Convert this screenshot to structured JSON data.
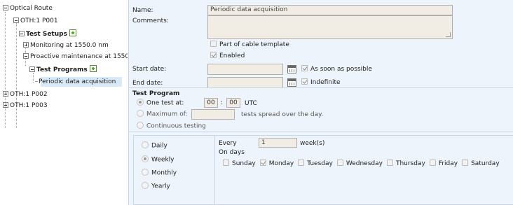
{
  "tree": {
    "root": "Optical Route",
    "oth1": "OTH:1 P001",
    "test_setups": "Test Setups",
    "monitoring": "Monitoring at 1550.0 nm",
    "proactive": "Proactive maintenance at 1550",
    "test_programs": "Test Programs",
    "periodic": "Periodic data acquisition",
    "oth2": "OTH:1 P002",
    "oth3": "OTH:1 P003"
  },
  "form": {
    "name_label": "Name:",
    "name_value": "Periodic data acquisition",
    "comments_label": "Comments:",
    "comments_value": "",
    "cable_template_label": "Part of cable template",
    "cable_template_checked": false,
    "enabled_label": "Enabled",
    "enabled_checked": true,
    "start_date_label": "Start date:",
    "start_date_value": "",
    "asap_label": "As soon as possible",
    "asap_checked": true,
    "end_date_label": "End date:",
    "end_date_value": "",
    "indefinite_label": "Indefinite",
    "indefinite_checked": true
  },
  "program": {
    "title": "Test Program",
    "one_test_label": "One test at:",
    "hour": "00",
    "colon": ":",
    "minute": "00",
    "tz": "UTC",
    "maximum_label": "Maximum of:",
    "maximum_value": "",
    "spread_label": "tests spread over the day.",
    "continuous_label": "Continuous testing",
    "selected_mode": "one_test"
  },
  "schedule": {
    "periods": [
      "Daily",
      "Weekly",
      "Monthly",
      "Yearly"
    ],
    "selected_period": "Weekly",
    "every_label": "Every",
    "every_value": "1",
    "unit_label": "week(s)",
    "on_days_label": "On days",
    "days": [
      {
        "label": "Sunday",
        "checked": false
      },
      {
        "label": "Monday",
        "checked": true
      },
      {
        "label": "Tuesday",
        "checked": false
      },
      {
        "label": "Wednesday",
        "checked": false
      },
      {
        "label": "Thursday",
        "checked": false
      },
      {
        "label": "Friday",
        "checked": false
      },
      {
        "label": "Saturday",
        "checked": false
      }
    ]
  },
  "colors": {
    "panel_bg": "#eef4fb",
    "field_bg": "#f2ede4",
    "selection_bg": "#d8e9f8",
    "add_icon_green": "#4caf30"
  }
}
